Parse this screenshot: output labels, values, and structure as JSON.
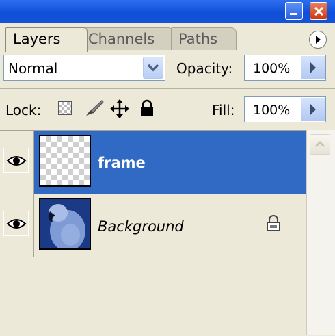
{
  "tabs": [
    {
      "label": "Layers",
      "active": true
    },
    {
      "label": "Channels",
      "active": false
    },
    {
      "label": "Paths",
      "active": false
    }
  ],
  "options": {
    "blend_mode": "Normal",
    "opacity_label": "Opacity:",
    "opacity_value": "100%",
    "lock_label": "Lock:",
    "fill_label": "Fill:",
    "fill_value": "100%"
  },
  "layers": [
    {
      "name": "frame",
      "visible": true,
      "selected": true,
      "locked": false
    },
    {
      "name": "Background",
      "visible": true,
      "selected": false,
      "locked": true
    }
  ],
  "colors": {
    "selection": "#316ac5",
    "panel": "#ece9d8",
    "titlebar": "#0f4fd8"
  },
  "icons": [
    "minimize-icon",
    "close-icon",
    "panel-menu-icon",
    "chevron-down-icon",
    "arrow-right-icon",
    "lock-transparent-icon",
    "lock-paint-icon",
    "lock-move-icon",
    "lock-all-icon",
    "eye-icon",
    "scroll-up-icon"
  ]
}
